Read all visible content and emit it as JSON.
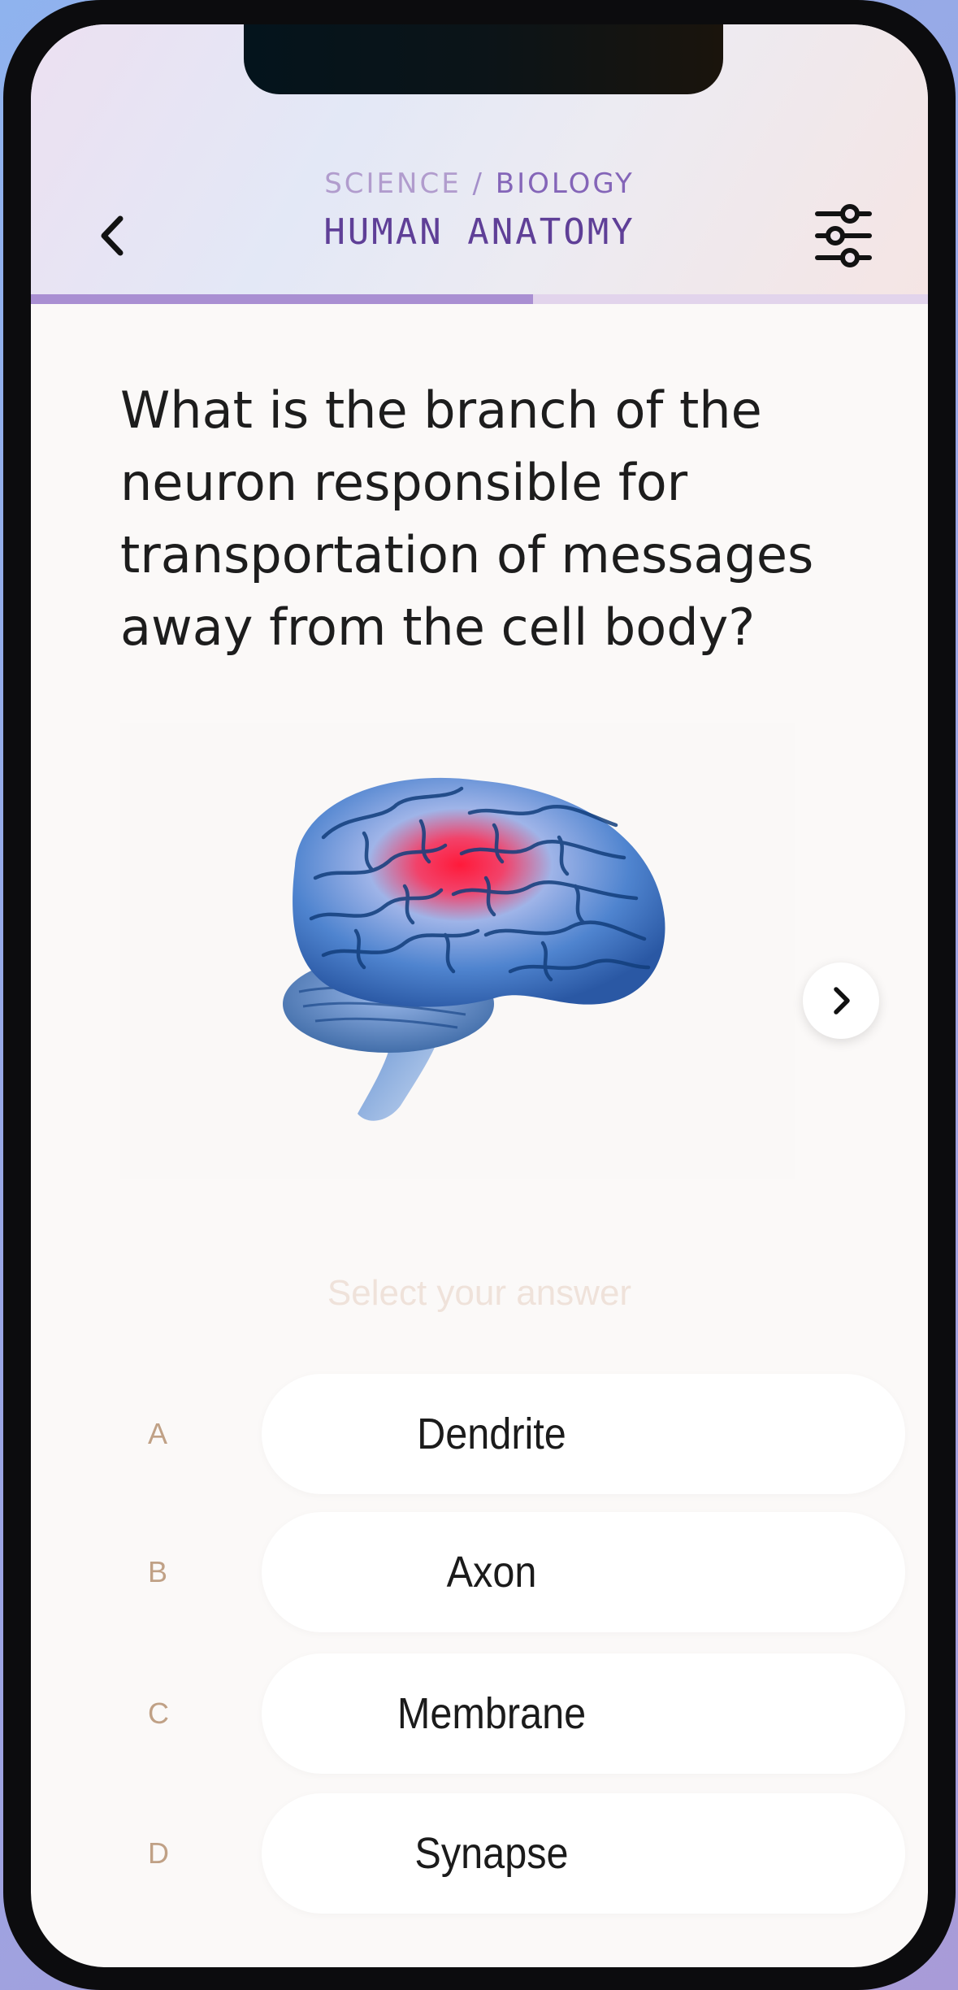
{
  "header": {
    "breadcrumb_parent": "SCIENCE",
    "breadcrumb_separator": "/",
    "breadcrumb_current": "BIOLOGY",
    "title": "HUMAN ANATOMY",
    "back_icon": "chevron-left-icon",
    "filter_icon": "sliders-icon",
    "progress": 0.56
  },
  "question": {
    "text": "What is the branch of the neuron responsible for transportation of messages away from the cell body?"
  },
  "media": {
    "image": "brain-illustration",
    "next_icon": "chevron-right-icon"
  },
  "answers": {
    "hint": "Select your answer",
    "options": [
      {
        "letter": "A",
        "label": "Dendrite"
      },
      {
        "letter": "B",
        "label": "Axon"
      },
      {
        "letter": "C",
        "label": "Membrane"
      },
      {
        "letter": "D",
        "label": "Synapse"
      }
    ]
  },
  "colors": {
    "accent": "#5f3f97",
    "progress": "#a98fd2",
    "letter": "#c0a186"
  }
}
